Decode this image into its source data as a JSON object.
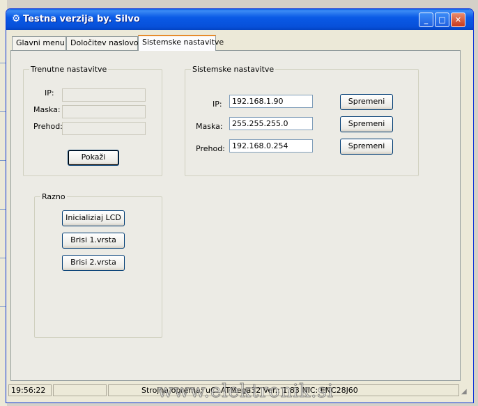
{
  "window": {
    "title": "Testna verzija by. Silvo",
    "controls": {
      "minimize": "_",
      "maximize": "□",
      "close": "✕"
    }
  },
  "tabs": [
    {
      "label": "Glavni menu",
      "active": false
    },
    {
      "label": "Določitev naslovov",
      "active": false
    },
    {
      "label": "Sistemske nastavitve",
      "active": true
    }
  ],
  "current_settings": {
    "title": "Trenutne nastavitve",
    "ip_label": "IP:",
    "mask_label": "Maska:",
    "gateway_label": "Prehod:",
    "ip_value": "",
    "mask_value": "",
    "gateway_value": "",
    "show_button": "Pokaži"
  },
  "system_settings": {
    "title": "Sistemske nastavitve",
    "ip_label": "IP:",
    "mask_label": "Maska:",
    "gateway_label": "Prehod:",
    "ip_value": "192.168.1.90",
    "mask_value": "255.255.255.0",
    "gateway_value": "192.168.0.254",
    "change_button": "Spremeni"
  },
  "misc": {
    "title": "Razno",
    "init_lcd": "Inicializiaj LCD",
    "clear_row1": "Brisi 1.vrsta",
    "clear_row2": "Brisi 2.vrsta"
  },
  "statusbar": {
    "time": "19:56:22",
    "empty": "",
    "hardware": "Strojna oprema: uC: ATMega32 Ver.: 1.83 NIC: ENC28J60"
  },
  "watermark": "www.elektronik.si",
  "colors": {
    "titlebar": "#0a5ae6",
    "window_bg": "#ece9d8",
    "active_tab_accent": "#e68b2c",
    "close_button": "#c5391d"
  },
  "icons": {
    "app": "app-icon",
    "resize": "resize-grip-icon"
  }
}
